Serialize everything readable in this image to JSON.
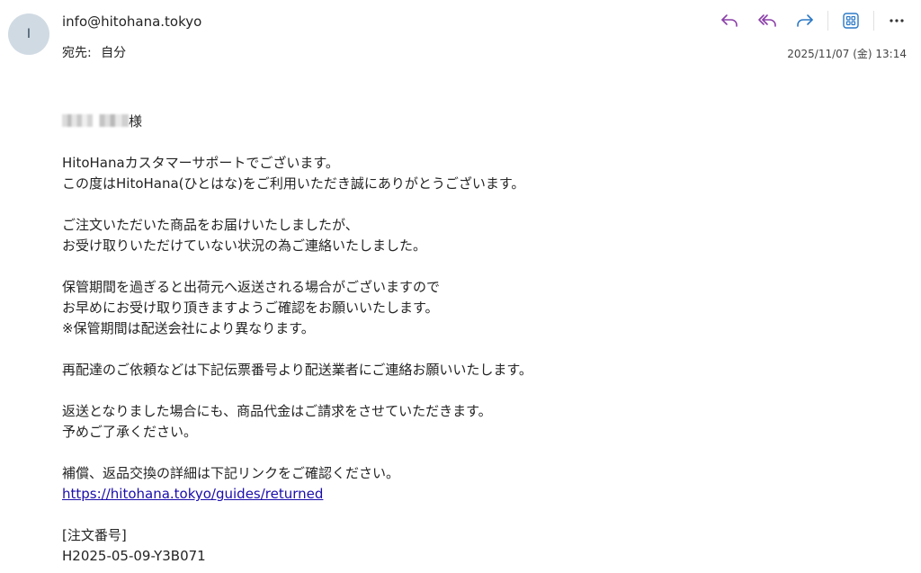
{
  "sender": {
    "avatar_initial": "I",
    "email": "info@hitohana.tokyo"
  },
  "recipient": {
    "label": "宛先:",
    "value": "自分"
  },
  "timestamp": "2025/11/07 (金) 13:14",
  "toolbar": {
    "icons": [
      "reply-icon",
      "reply-all-icon",
      "forward-icon",
      "apps-icon",
      "more-icon"
    ],
    "colors": {
      "reply": "#8a3ea8",
      "forward": "#2b78c5",
      "apps": "#2b78c5",
      "more": "#333333"
    }
  },
  "body": {
    "greeting_suffix": "様",
    "p1": [
      "HitoHanaカスタマーサポートでございます。",
      "この度はHitoHana(ひとはな)をご利用いただき誠にありがとうございます。"
    ],
    "p2": [
      "ご注文いただいた商品をお届けいたしましたが、",
      "お受け取りいただけていない状況の為ご連絡いたしました。"
    ],
    "p3": [
      "保管期間を過ぎると出荷元へ返送される場合がございますので",
      "お早めにお受け取り頂きますようご確認をお願いいたします。",
      "※保管期間は配送会社により異なります。"
    ],
    "p4": [
      "再配達のご依頼などは下記伝票番号より配送業者にご連絡お願いいたします。"
    ],
    "p5": [
      "返送となりました場合にも、商品代金はご請求をさせていただきます。",
      "予めご了承ください。"
    ],
    "p6": [
      "補償、返品交換の詳細は下記リンクをご確認ください。"
    ],
    "link": "https://hitohana.tokyo/guides/returned",
    "order_label": "[注文番号]",
    "order_number_partial": "H2025-05-09-Y3B071"
  }
}
